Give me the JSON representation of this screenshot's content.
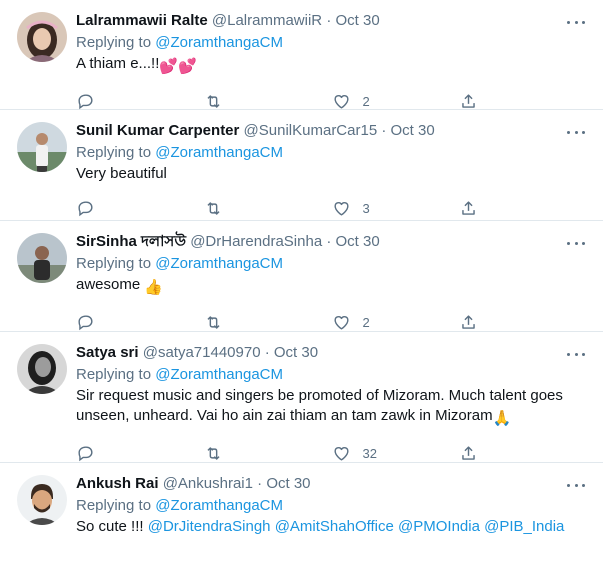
{
  "tweets": [
    {
      "name": "Lalrammawii Ralte",
      "handle": "@LalrammawiiR",
      "dot": "·",
      "date": "Oct 30",
      "replying_prefix": "Replying to",
      "replying_to": "@ZoramthangaCM",
      "text": "A thiam e...!!",
      "emoji": "💕💕",
      "likes": "2"
    },
    {
      "name": "Sunil Kumar Carpenter",
      "handle": "@SunilKumarCar15",
      "dot": "·",
      "date": "Oct 30",
      "replying_prefix": "Replying to",
      "replying_to": "@ZoramthangaCM",
      "text": "Very beautiful",
      "likes": "3"
    },
    {
      "name": "SirSinha দলাসউ",
      "handle": "@DrHarendraSinha",
      "dot": "·",
      "date": "Oct 30",
      "replying_prefix": "Replying to",
      "replying_to": "@ZoramthangaCM",
      "text": "awesome",
      "emoji": "👍",
      "likes": "2"
    },
    {
      "name": "Satya sri",
      "handle": "@satya71440970",
      "dot": "·",
      "date": "Oct 30",
      "replying_prefix": "Replying to",
      "replying_to": "@ZoramthangaCM",
      "text": "Sir request music and singers be promoted of Mizoram. Much talent goes unseen, unheard. Vai ho ain zai thiam an tam zawk in Mizoram",
      "emoji": "🙏",
      "likes": "32"
    },
    {
      "name": "Ankush Rai",
      "handle": "@Ankushrai1",
      "dot": "·",
      "date": "Oct 30",
      "replying_prefix": "Replying to",
      "replying_to": "@ZoramthangaCM",
      "text_prefix": "So cute !!!",
      "mentions": [
        "@DrJitendraSingh",
        "@AmitShahOffice",
        "@PMOIndia",
        "@PIB_India"
      ]
    }
  ],
  "icons": {
    "reply": "reply-icon",
    "retweet": "retweet-icon",
    "like": "like-icon",
    "share": "share-icon",
    "more": "more-icon"
  },
  "colors": {
    "link": "#1b95e0",
    "secondary_text": "#5b7083",
    "divider": "#e1e8ed"
  }
}
